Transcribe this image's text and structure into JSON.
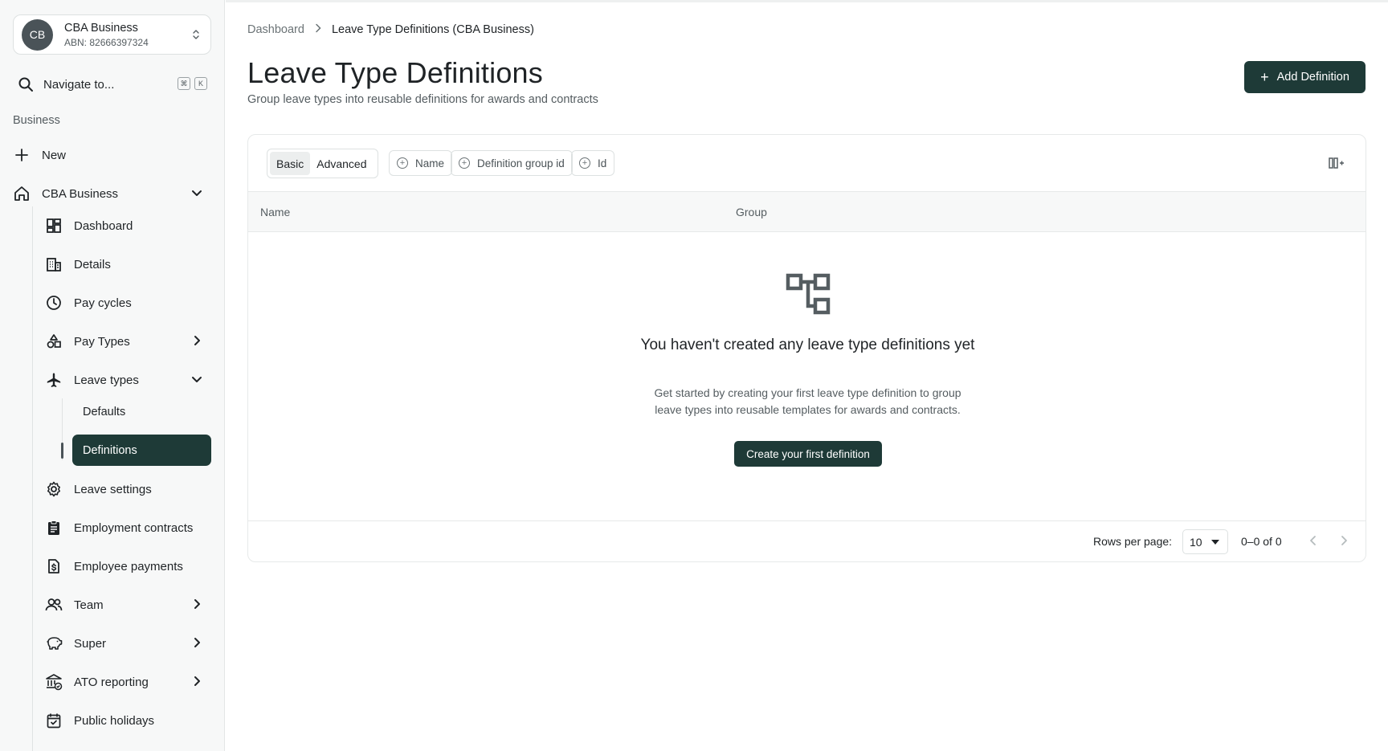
{
  "business": {
    "initials": "CB",
    "name": "CBA Business",
    "abn": "ABN: 82666397324"
  },
  "search": {
    "label": "Navigate to...",
    "kbd1": "⌘",
    "kbd2": "K"
  },
  "sidebar": {
    "section": "Business",
    "new_label": "New",
    "group_label": "CBA Business",
    "items": [
      {
        "label": "Dashboard",
        "icon": "dashboard-icon"
      },
      {
        "label": "Details",
        "icon": "building-icon"
      },
      {
        "label": "Pay cycles",
        "icon": "clock-icon"
      },
      {
        "label": "Pay Types",
        "icon": "shapes-icon"
      },
      {
        "label": "Leave types",
        "icon": "plane-icon"
      },
      {
        "label": "Leave settings",
        "icon": "gear-icon"
      },
      {
        "label": "Employment contracts",
        "icon": "clipboard-icon"
      },
      {
        "label": "Employee payments",
        "icon": "dollar-file-icon"
      },
      {
        "label": "Team",
        "icon": "users-icon"
      },
      {
        "label": "Super",
        "icon": "piggy-bank-icon"
      },
      {
        "label": "ATO reporting",
        "icon": "bank-check-icon"
      },
      {
        "label": "Public holidays",
        "icon": "calendar-check-icon"
      }
    ],
    "leave_sub": [
      "Defaults",
      "Definitions"
    ]
  },
  "breadcrumb": {
    "home": "Dashboard",
    "current": "Leave Type Definitions (CBA Business)"
  },
  "page": {
    "title": "Leave Type Definitions",
    "subtitle": "Group leave types into reusable definitions for awards and contracts",
    "add_label": "Add Definition"
  },
  "filters": {
    "basic": "Basic",
    "advanced": "Advanced",
    "chips": [
      "Name",
      "Definition group id",
      "Id"
    ]
  },
  "table": {
    "columns": [
      "Name",
      "Group"
    ]
  },
  "empty": {
    "title": "You haven't created any leave type definitions yet",
    "description": "Get started by creating your first leave type definition to group leave types into reusable templates for awards and contracts.",
    "button": "Create your first definition"
  },
  "pagination": {
    "rows_label": "Rows per page:",
    "rows_value": "10",
    "range": "0–0 of 0"
  },
  "colors": {
    "accent": "#1e3a37",
    "sidebar_bg": "#f7f8f8"
  }
}
